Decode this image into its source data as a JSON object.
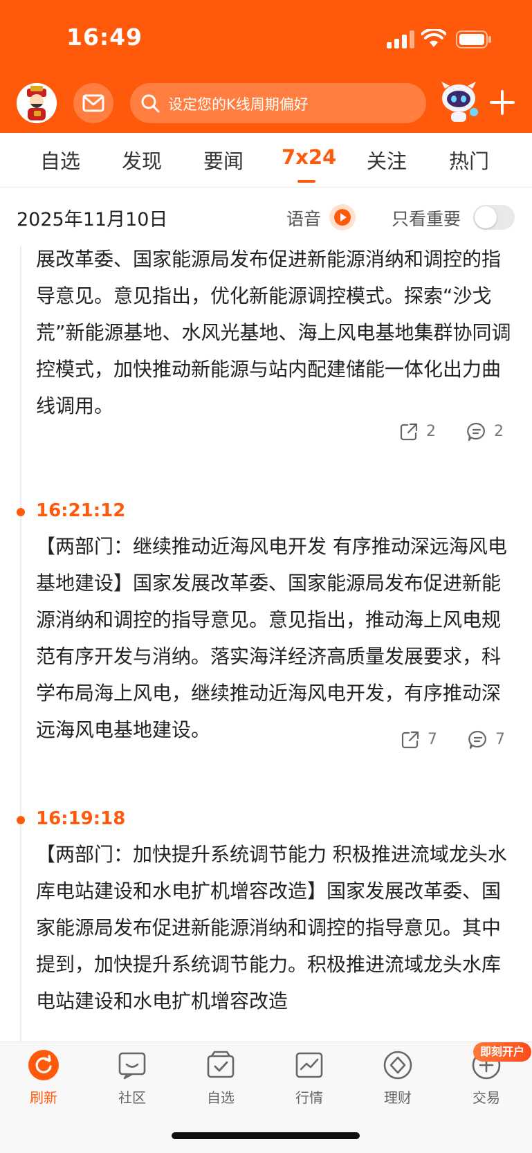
{
  "status_bar": {
    "time": "16:49"
  },
  "header": {
    "search_placeholder": "设定您的K线周期偏好"
  },
  "tabs": [
    {
      "label": "自选"
    },
    {
      "label": "发现"
    },
    {
      "label": "要闻"
    },
    {
      "label": "7x24",
      "active": true
    },
    {
      "label": "关注"
    },
    {
      "label": "热门"
    }
  ],
  "date_bar": {
    "date": "2025年11月10日",
    "voice_label": "语音",
    "important_only_label": "只看重要",
    "important_only_on": false
  },
  "feed": [
    {
      "time": "",
      "text": "展改革委、国家能源局发布促进新能源消纳和调控的指导意见。意见指出，优化新能源调控模式。探索“沙戈荒”新能源基地、水风光基地、海上风电基地集群协同调控模式，加快推动新能源与站内配建储能一体化出力曲线调用。",
      "shares": "2",
      "comments": "2"
    },
    {
      "time": "16:21:12",
      "text": "【两部门：继续推动近海风电开发 有序推动深远海风电基地建设】国家发展改革委、国家能源局发布促进新能源消纳和调控的指导意见。意见指出，推动海上风电规范有序开发与消纳。落实海洋经济高质量发展要求，科学布局海上风电，继续推动近海风电开发，有序推动深远海风电基地建设。",
      "shares": "7",
      "comments": "7"
    },
    {
      "time": "16:19:18",
      "text": "【两部门：加快提升系统调节能力 积极推进流域龙头水库电站建设和水电扩机增容改造】国家发展改革委、国家能源局发布促进新能源消纳和调控的指导意见。其中提到，加快提升系统调节能力。积极推进流域龙头水库电站建设和水电扩机增容改造",
      "shares": "",
      "comments": ""
    }
  ],
  "bottom_nav": {
    "items": [
      {
        "label": "刷新",
        "icon": "refresh-icon",
        "active": true
      },
      {
        "label": "社区",
        "icon": "community-icon"
      },
      {
        "label": "自选",
        "icon": "watchlist-icon"
      },
      {
        "label": "行情",
        "icon": "market-icon"
      },
      {
        "label": "理财",
        "icon": "wealth-icon"
      },
      {
        "label": "交易",
        "icon": "trade-icon"
      }
    ],
    "badge": "即刻开户"
  },
  "colors": {
    "brand": "#ff5a0b",
    "text": "#222222",
    "muted": "#777777"
  }
}
